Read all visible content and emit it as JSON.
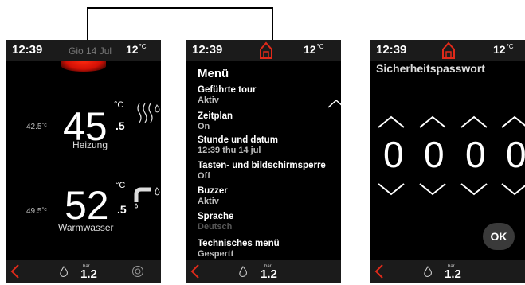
{
  "screen1": {
    "time": "12:39",
    "date": "Gio 14 Jul",
    "outdoor_temp": "12",
    "temp_unit": "°C",
    "heating": {
      "target": "42.5",
      "target_unit": "°c",
      "value": "45",
      "unit": "°C",
      "decimal": ".5",
      "label": "Heizung"
    },
    "water": {
      "target": "49.5",
      "target_unit": "°c",
      "value": "52",
      "unit": "°C",
      "decimal": ".5",
      "label": "Warmwasser"
    },
    "pressure_unit": "bar",
    "pressure": "1.2"
  },
  "screen2": {
    "time": "12:39",
    "outdoor_temp": "12",
    "temp_unit": "°C",
    "menu_title": "Menü",
    "items": [
      {
        "title": "Geführte tour",
        "value": "Aktiv"
      },
      {
        "title": "Zeitplan",
        "value": "On"
      },
      {
        "title": "Stunde und datum",
        "value": "12:39 thu 14 jul"
      },
      {
        "title": "Tasten- und bildschirmsperre",
        "value": "Off"
      },
      {
        "title": "Buzzer",
        "value": "Aktiv"
      },
      {
        "title": "Sprache",
        "value": "Deutsch"
      },
      {
        "title": "Technisches menü",
        "value": "Gespertt"
      }
    ],
    "pressure_unit": "bar",
    "pressure": "1.2"
  },
  "screen3": {
    "time": "12:39",
    "outdoor_temp": "12",
    "temp_unit": "°C",
    "title": "Sicherheitspasswort",
    "digits": [
      "0",
      "0",
      "0",
      "0"
    ],
    "ok_label": "OK",
    "pressure_unit": "bar",
    "pressure": "1.2"
  },
  "colors": {
    "accent_red": "#e02a1a",
    "background": "#000000",
    "bar": "#1b1b1b"
  },
  "icons": [
    "home-icon",
    "back-arrow-icon",
    "flame-icon",
    "radiator-icon",
    "faucet-icon",
    "chevron-up-icon",
    "chevron-down-icon"
  ]
}
